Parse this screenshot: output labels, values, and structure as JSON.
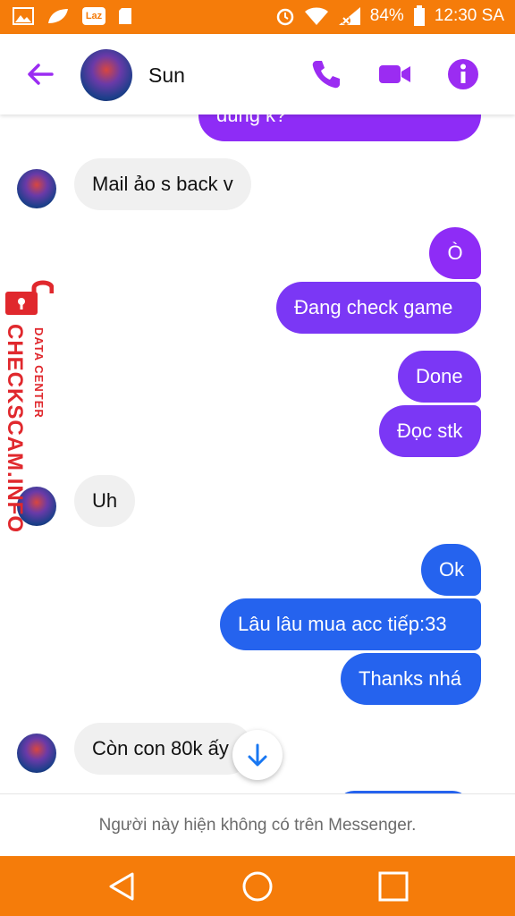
{
  "status_bar": {
    "battery": "84%",
    "time": "12:30 SA",
    "left_icons": [
      "gallery-icon",
      "leaf-icon",
      "lazada-icon",
      "sd-card-icon"
    ],
    "lazada_label": "Laz"
  },
  "header": {
    "contact_name": "Sun",
    "accent_color": "#9b2cf2"
  },
  "messages": [
    {
      "side": "sent",
      "text": "đúng k?",
      "color": "#8e2cf6"
    },
    {
      "side": "received",
      "text": "Mail ảo s back v"
    },
    {
      "side": "sent",
      "text": "Ò",
      "color": "#8e2cf6"
    },
    {
      "side": "sent",
      "text": "Đang check game",
      "color": "#7b37f5"
    },
    {
      "side": "sent",
      "text": "Done",
      "color": "#7b37f5"
    },
    {
      "side": "sent",
      "text": "Đọc stk",
      "color": "#7b37f5"
    },
    {
      "side": "received",
      "text": "Uh"
    },
    {
      "side": "sent",
      "text": "Ok",
      "color": "#2563ee"
    },
    {
      "side": "sent",
      "text": "Lâu lâu mua acc tiếp:33",
      "color": "#2563ee"
    },
    {
      "side": "sent",
      "text": "Thanks nhá",
      "color": "#2563ee"
    },
    {
      "side": "received",
      "text": "Còn con 80k ấy"
    }
  ],
  "footer": {
    "note": "Người này hiện không có trên Messenger."
  },
  "watermark": {
    "brand": "CHECKSCAM.INFO",
    "sub": "DATA CENTER"
  }
}
